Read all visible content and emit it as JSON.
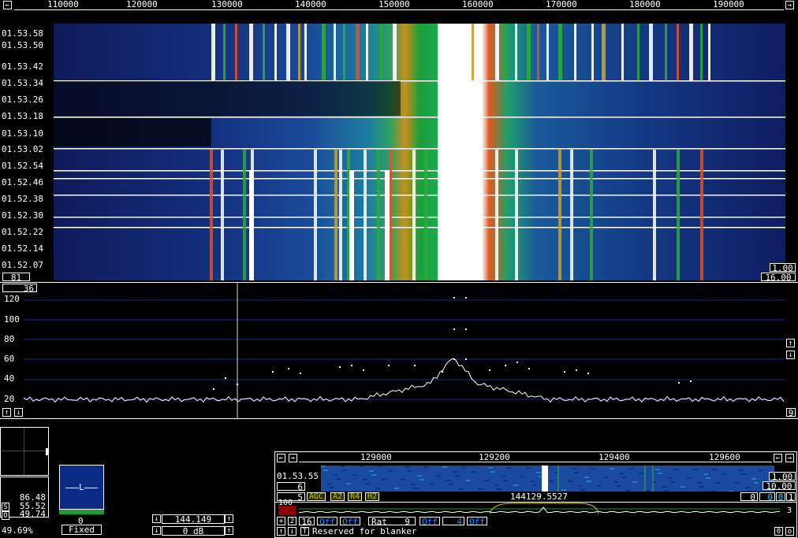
{
  "main_axis": {
    "ticks": [
      "110000",
      "120000",
      "130000",
      "140000",
      "150000",
      "160000",
      "170000",
      "180000",
      "190000"
    ]
  },
  "waterfall": {
    "timestamps": [
      "01.53.58",
      "01.53.50",
      "01.53.42",
      "01.53.34",
      "01.53.26",
      "01.53.18",
      "01.53.10",
      "01.53.02",
      "01.52.54",
      "01.52.46",
      "01.52.38",
      "01.52.30",
      "01.52.22",
      "01.52.14",
      "01.52.07"
    ],
    "left_value": "81",
    "right_top_value": "1.00",
    "right_bottom_value": "16.00"
  },
  "spectrum": {
    "top_value": "36",
    "y_ticks": [
      "120",
      "100",
      "80",
      "60",
      "40",
      "20"
    ],
    "right_value": "9"
  },
  "small_panel": {
    "s_label": "S",
    "s_value": "55.52",
    "o_label": "O",
    "o_value": "49.74",
    "top_value": "86.48",
    "percent": "49.69%"
  },
  "meter": {
    "letter": "L",
    "value": "0",
    "mode": "Fixed"
  },
  "freq_box": {
    "freq": "144.149",
    "gain": "0 dB"
  },
  "zoom": {
    "axis_ticks": [
      "129000",
      "129200",
      "129400",
      "129600"
    ],
    "timestamp": "01.53.55",
    "left_value": "6",
    "right_top": "1.00",
    "right_bottom": "10.00",
    "ctrl_num": "5",
    "tags": [
      "AGC",
      "A2",
      "R4",
      "H2"
    ],
    "right_nums": [
      "0",
      "0",
      "0",
      "1"
    ],
    "spec_top": "100",
    "freq_readout": "144129.5527",
    "right_small": "3",
    "row_a": [
      "2",
      "16"
    ],
    "off1": "Off",
    "off2": "Off",
    "rat_label": "Rat",
    "rat_value": "9",
    "off3": "Off",
    "num4": "4",
    "off4": "Off",
    "row_b_letter": "T",
    "status": "Reserved for blanker",
    "br_value": "0",
    "br_letter": "o"
  }
}
